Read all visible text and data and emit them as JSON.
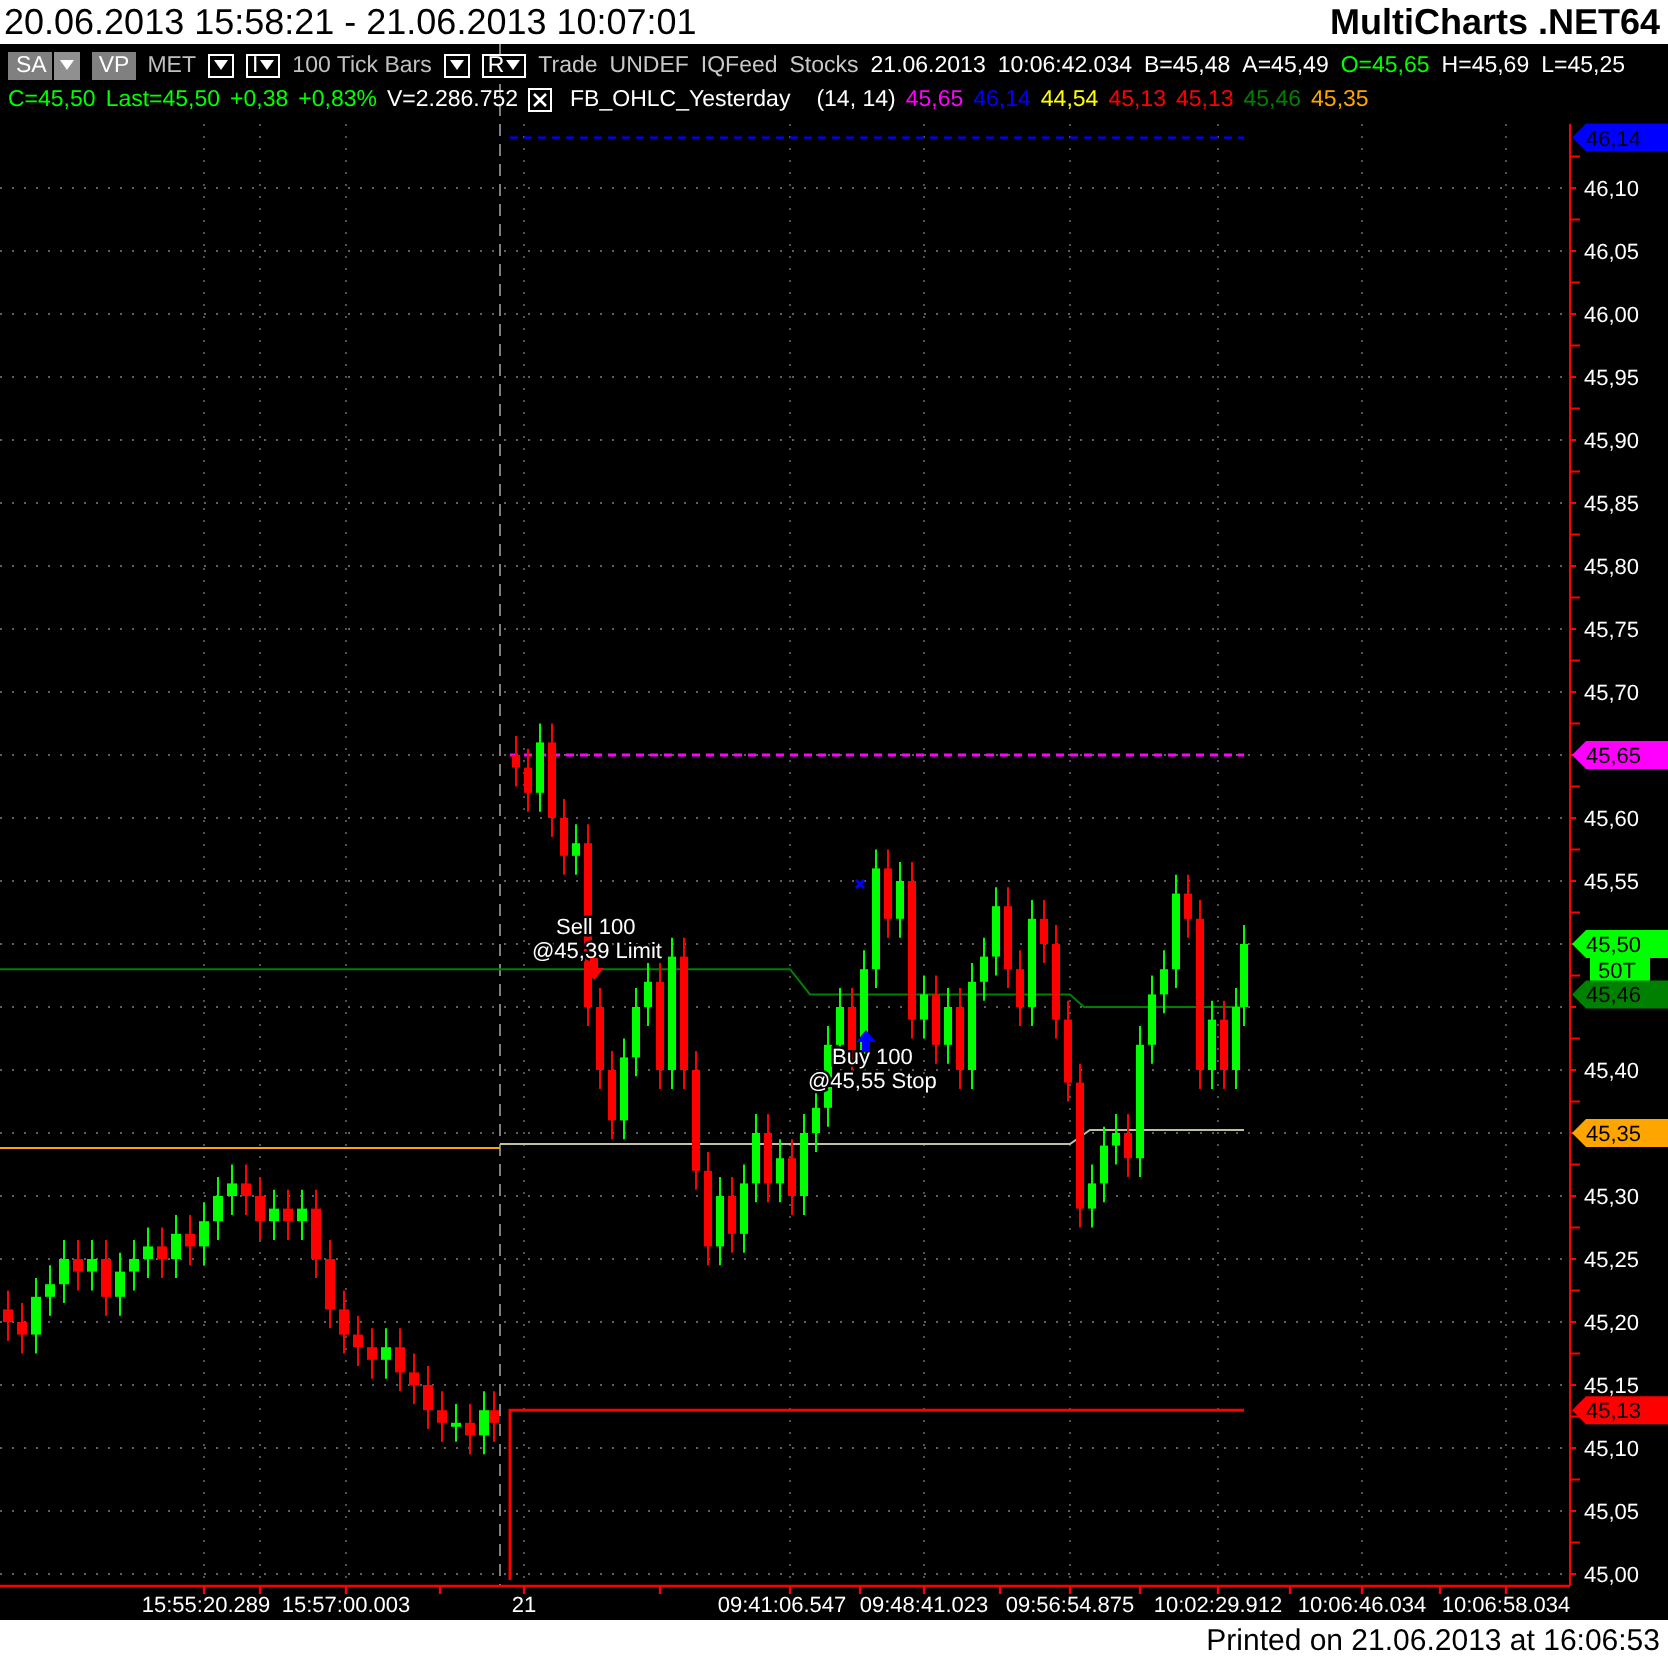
{
  "title_bar": {
    "date_range": "20.06.2013 15:58:21 - 21.06.2013 10:07:01",
    "app_name": "MultiCharts .NET64"
  },
  "toolbar": [
    {
      "kind": "menu",
      "label": "SA"
    },
    {
      "kind": "toggle",
      "label": "VP"
    },
    {
      "kind": "label",
      "label": "MET"
    },
    {
      "kind": "dropdown"
    },
    {
      "kind": "letter_dropdown",
      "label": "I"
    },
    {
      "kind": "label",
      "label": "100 Tick Bars"
    },
    {
      "kind": "dropdown"
    },
    {
      "kind": "letter_dropdown",
      "label": "R"
    }
  ],
  "symbol_info": [
    {
      "text": "Trade",
      "color": "#c8c8c8"
    },
    {
      "text": "UNDEF",
      "color": "#c8c8c8"
    },
    {
      "text": "IQFeed",
      "color": "#c8c8c8"
    },
    {
      "text": "Stocks",
      "color": "#c8c8c8"
    },
    {
      "text": "21.06.2013",
      "color": "#ffffff"
    },
    {
      "text": "10:06:42.034",
      "color": "#ffffff"
    },
    {
      "text": "B=45,48",
      "color": "#ffffff"
    },
    {
      "text": "A=45,49",
      "color": "#ffffff"
    },
    {
      "text": "O=45,65",
      "color": "#00ff00"
    },
    {
      "text": "H=45,69",
      "color": "#ffffff"
    },
    {
      "text": "L=45,25",
      "color": "#ffffff"
    }
  ],
  "quote_line": [
    {
      "text": "C=45,50",
      "color": "#00ff00"
    },
    {
      "text": "Last=45,50",
      "color": "#00ff00"
    },
    {
      "text": "+0,38",
      "color": "#00ff00"
    },
    {
      "text": "+0,83%",
      "color": "#00ff00"
    },
    {
      "text": "V=2.286.752",
      "color": "#ffffff"
    }
  ],
  "study": {
    "checked": true,
    "name": "FB_OHLC_Yesterday",
    "params": "(14, 14)",
    "values": [
      {
        "text": "45,65",
        "color": "#ff00ff"
      },
      {
        "text": "46,14",
        "color": "#0000ff"
      },
      {
        "text": "44,54",
        "color": "#ffff00"
      },
      {
        "text": "45,13",
        "color": "#ff0000"
      },
      {
        "text": "45,13",
        "color": "#ff0000"
      },
      {
        "text": "45,46",
        "color": "#008000"
      },
      {
        "text": "45,35",
        "color": "#ffa500"
      }
    ]
  },
  "price_axis": {
    "labels": [
      "46,10",
      "46,05",
      "46,00",
      "45,95",
      "45,90",
      "45,85",
      "45,80",
      "45,75",
      "45,70",
      "45,60",
      "45,55",
      "45,40",
      "45,30",
      "45,25",
      "45,20",
      "45,15",
      "45,10",
      "45,05",
      "45,00"
    ],
    "tags": [
      {
        "label": "46,14",
        "color": "#0000ff"
      },
      {
        "label": "45,65",
        "color": "#ff00ff"
      },
      {
        "label": "45,50",
        "color": "#00ff00"
      },
      {
        "label": "50T",
        "color": "#00ff00"
      },
      {
        "label": "45,46",
        "color": "#008000"
      },
      {
        "label": "45,35",
        "color": "#ffa500"
      },
      {
        "label": "45,13",
        "color": "#ff0000"
      }
    ]
  },
  "time_axis": {
    "labels": [
      "15:55:20.289",
      "15:57:00.003",
      "21",
      "09:41:06.547",
      "09:48:41.023",
      "09:56:54.875",
      "10:02:29.912",
      "10:06:46.034",
      "10:06:58.034"
    ]
  },
  "orders": [
    {
      "kind": "sell",
      "action": "Sell 100",
      "price": "@45,39 Limit"
    },
    {
      "kind": "buy",
      "action": "Buy 100",
      "price": "@45,55 Stop"
    }
  ],
  "footer": {
    "printed": "Printed on 21.06.2013 at 16:06:53"
  }
}
